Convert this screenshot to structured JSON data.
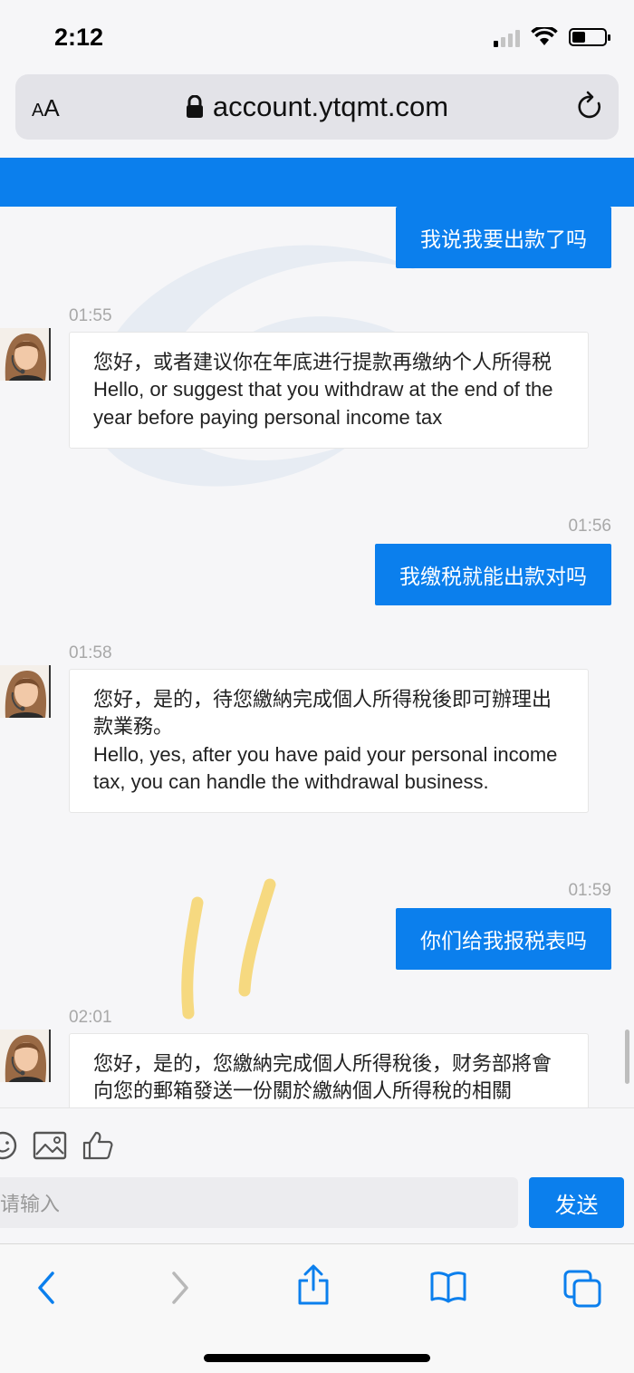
{
  "status": {
    "time": "2:12"
  },
  "browser": {
    "text_size_label": "AA",
    "url": "account.ytqmt.com"
  },
  "messages": [
    {
      "side": "right",
      "text": "我说我要出款了吗"
    },
    {
      "side": "left",
      "time": "01:55",
      "lines": [
        "您好，或者建议你在年底进行提款再缴纳个人所得税",
        "Hello, or suggest that you withdraw at the end of the year before paying personal income tax"
      ]
    },
    {
      "side": "right",
      "time": "01:56",
      "text": "我缴税就能出款对吗"
    },
    {
      "side": "left",
      "time": "01:58",
      "lines": [
        "您好，是的，待您繳納完成個人所得稅後即可辦理出款業務。",
        "Hello, yes, after you have paid your personal income tax, you can handle the withdrawal business."
      ]
    },
    {
      "side": "right",
      "time": "01:59",
      "text": "你们给我报税表吗"
    },
    {
      "side": "left",
      "time": "02:01",
      "lines": [
        "您好，是的，您繳納完成個人所得稅後，财务部將會向您的郵箱發送一份關於繳納個人所得稅的相關"
      ]
    }
  ],
  "composer": {
    "placeholder": "请输入",
    "send_label": "发送"
  },
  "icons": {
    "lock": "lock-icon",
    "reload": "reload-icon",
    "emoji": "emoji-icon",
    "image": "image-icon",
    "like": "thumbs-up-icon",
    "back": "back-icon",
    "forward": "forward-icon",
    "share": "share-icon",
    "bookmarks": "bookmarks-icon",
    "tabs": "tabs-icon"
  },
  "colors": {
    "accent": "#0b7fed",
    "bubble_left": "#ffffff",
    "highlight": "#f6d36b"
  }
}
